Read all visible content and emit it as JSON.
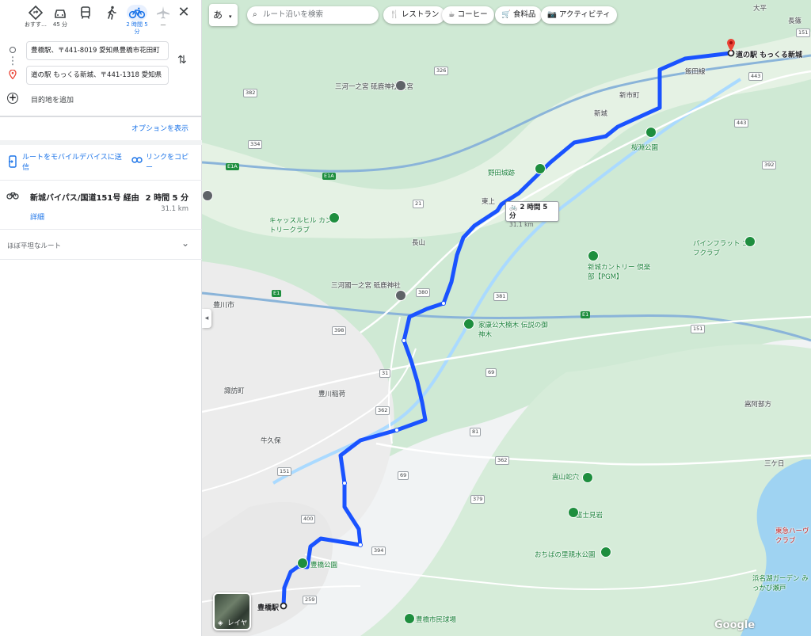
{
  "travel_modes": [
    {
      "name": "best-mode-button",
      "label": "おすす…"
    },
    {
      "name": "driving-mode-button",
      "label": "45 分"
    },
    {
      "name": "transit-mode-button",
      "label": ""
    },
    {
      "name": "walking-mode-button",
      "label": ""
    },
    {
      "name": "cycling-mode-button",
      "label": "2 時間 5 分"
    },
    {
      "name": "flight-mode-button",
      "label": "—"
    }
  ],
  "origin_value": "豊橋駅、〒441-8019 愛知県豊橋市花田町",
  "destination_value": "道の駅 もっくる新城、〒441-1318 愛知県",
  "add_destination_label": "目的地を追加",
  "options_label": "オプションを表示",
  "send_to_device_label": "ルートをモバイルデバイスに送信",
  "copy_link_label": "リンクをコピー",
  "route": {
    "title": "新城バイパス/国道151号 経由",
    "time": "2 時間 5 分",
    "distance": "31.1 km",
    "details_label": "詳細",
    "mostly_flat_label": "ほぼ平坦なルート"
  },
  "map": {
    "lang_button": "あ",
    "search_placeholder": "ルート沿いを検索",
    "chips": [
      "レストラン",
      "コーヒー",
      "食料品",
      "アクティビティ"
    ],
    "route_callout_time": "2 時間 5 分",
    "route_callout_distance": "31.1 km",
    "start_label": "豊橋駅",
    "end_label": "道の駅 もっくる新城",
    "layers_label": "レイヤ",
    "logo": "Google",
    "place_labels": {
      "ichinomiya_okumiya": "三河一之宮 砥鹿神社 奥宮",
      "sakurabuchi": "桜淵公園",
      "shinshiro": "新城",
      "higashishinmachi": "新市町",
      "nodajo": "野田城跡",
      "castlehill": "キャッスルヒル カントリークラブ",
      "pineflat": "パインフラット ゴルフクラブ",
      "shinshirocc": "新城カントリー 倶楽部【PGM】",
      "toganjinja": "三河國一之宮 砥鹿神社",
      "toyokawa_city": "豊川市",
      "kazokukoen": "家康公大楠木 伝説の御神木",
      "toyokawa_inari": "豊川稲荷",
      "suwacho": "諏訪町",
      "ushikubo": "牛久保",
      "takayamabunkyo": "嵩山蛇穴",
      "fujimiiwa": "富士見岩",
      "ochiba": "おちばの里親水公園",
      "toyohashi_park": "豊橋公園",
      "toyohashi_shimin": "豊橋市民球場",
      "nagayama": "長山",
      "higashikami": "東上",
      "kanzawa": "嵩阿部方",
      "sangaku": "三ケ日",
      "tsukude": "大平",
      "higashi": "東急ハーヴ クラブ",
      "hamana": "浜名湖ガーデン みっかび瀬戸",
      "iida": "飯田線",
      "nagashino": "長篠"
    },
    "route_shields": [
      "151",
      "326",
      "382",
      "334",
      "E1A",
      "21",
      "380",
      "381",
      "398",
      "31",
      "362",
      "69",
      "400",
      "394",
      "379",
      "E1",
      "69",
      "81",
      "443",
      "392",
      "151",
      "259",
      "1",
      "4",
      "362",
      "E1A"
    ]
  }
}
